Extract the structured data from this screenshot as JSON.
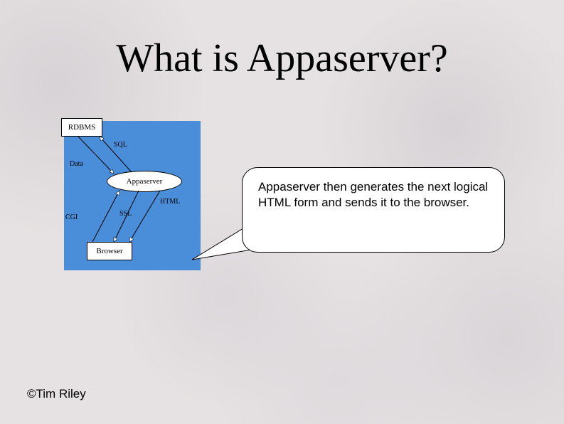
{
  "slide": {
    "title": "What is Appaserver?",
    "copyright": "©Tim Riley"
  },
  "diagram": {
    "boxes": {
      "rdbms": "RDBMS",
      "appaserver": "Appaserver",
      "browser": "Browser"
    },
    "edge_labels": {
      "sql": "SQL",
      "data": "Data",
      "html": "HTML",
      "ssl": "SSL",
      "cgi": "CGI"
    }
  },
  "callout": {
    "text": "Appaserver then generates the next logical HTML form and sends it to the browser."
  }
}
